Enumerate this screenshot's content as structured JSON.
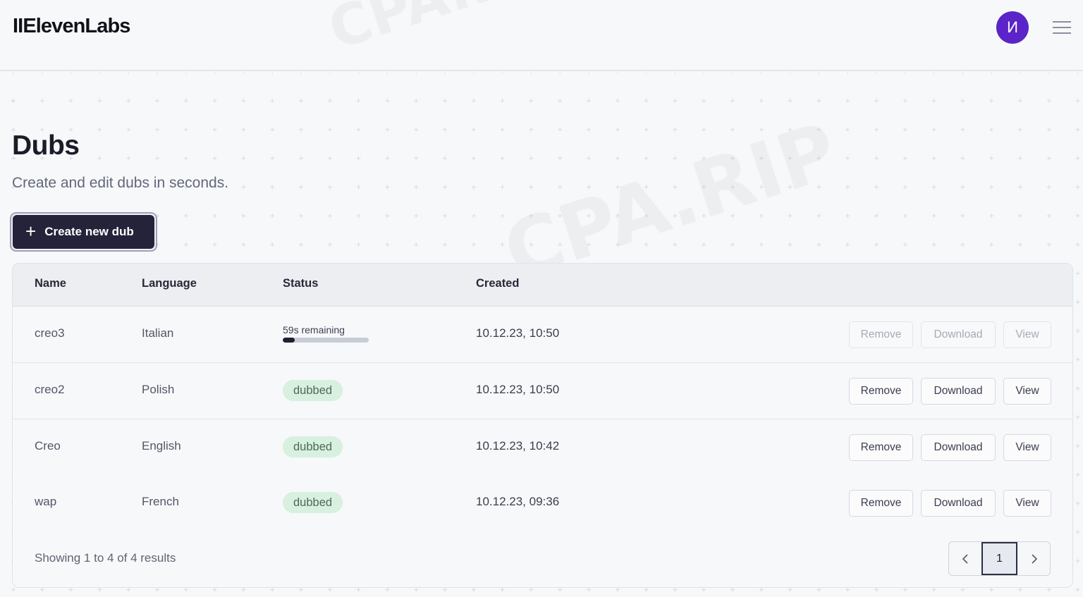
{
  "header": {
    "logo": "IIElevenLabs",
    "avatar_initial": "И"
  },
  "page": {
    "title": "Dubs",
    "subtitle": "Create and edit dubs in seconds.",
    "create_button": "Create new dub"
  },
  "table": {
    "columns": [
      "Name",
      "Language",
      "Status",
      "Created"
    ],
    "rows": [
      {
        "name": "creo3",
        "language": "Italian",
        "status_type": "progress",
        "status_text": "59s remaining",
        "progress": 0.14,
        "created": "10.12.23, 10:50",
        "actions_enabled": false
      },
      {
        "name": "creo2",
        "language": "Polish",
        "status_type": "badge",
        "status_text": "dubbed",
        "created": "10.12.23, 10:50",
        "actions_enabled": true
      },
      {
        "name": "Creo",
        "language": "English",
        "status_type": "badge",
        "status_text": "dubbed",
        "created": "10.12.23, 10:42",
        "actions_enabled": true
      },
      {
        "name": "wap",
        "language": "French",
        "status_type": "badge",
        "status_text": "dubbed",
        "created": "10.12.23, 09:36",
        "actions_enabled": true
      }
    ],
    "actions": {
      "remove": "Remove",
      "download": "Download",
      "view": "View"
    }
  },
  "footer": {
    "showing_text": "Showing 1 to 4 of 4 results",
    "current_page": "1"
  },
  "colors": {
    "avatar_bg": "#5a24c9",
    "button_dark": "#24233a",
    "badge_bg": "#d7f0df"
  },
  "watermark": "CPA.RIP"
}
